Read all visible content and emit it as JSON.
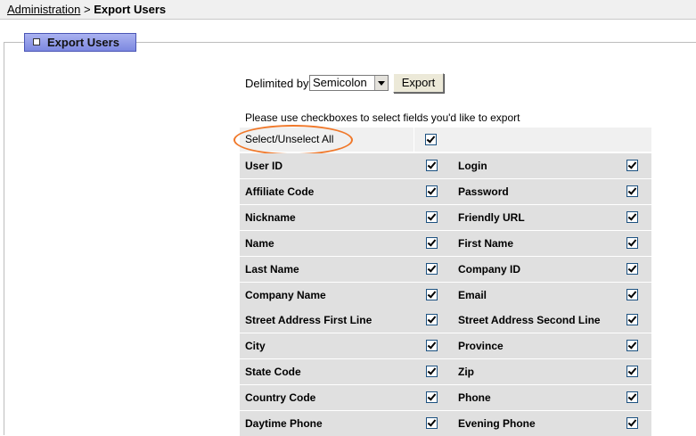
{
  "breadcrumb": {
    "link": "Administration",
    "separator": " > ",
    "current": "Export Users"
  },
  "panel": {
    "title": "Export Users"
  },
  "form": {
    "delimited_label": "Delimited by",
    "delimiter_value": "Semicolon",
    "export_label": "Export",
    "instructions": "Please use checkboxes to select fields you'd like to export",
    "select_all_label": "Select/Unselect All",
    "select_all_checked": true
  },
  "rows": [
    {
      "left": "User ID",
      "right": "Login"
    },
    {
      "left": "Affiliate Code",
      "right": "Password"
    },
    {
      "left": "Nickname",
      "right": "Friendly URL"
    },
    {
      "left": "Name",
      "right": "First Name"
    },
    {
      "left": "Last Name",
      "right": "Company ID"
    },
    {
      "left": "Company Name",
      "right": "Email"
    },
    {
      "left": "Street Address First Line",
      "right": "Street Address Second Line"
    },
    {
      "left": "City",
      "right": "Province"
    },
    {
      "left": "State Code",
      "right": "Zip"
    },
    {
      "left": "Country Code",
      "right": "Phone"
    },
    {
      "left": "Daytime Phone",
      "right": "Evening Phone"
    }
  ],
  "colors": {
    "tab": "#7c88e0",
    "highlight_oval": "#f0782a",
    "row_bg": "#e0e0e0"
  }
}
